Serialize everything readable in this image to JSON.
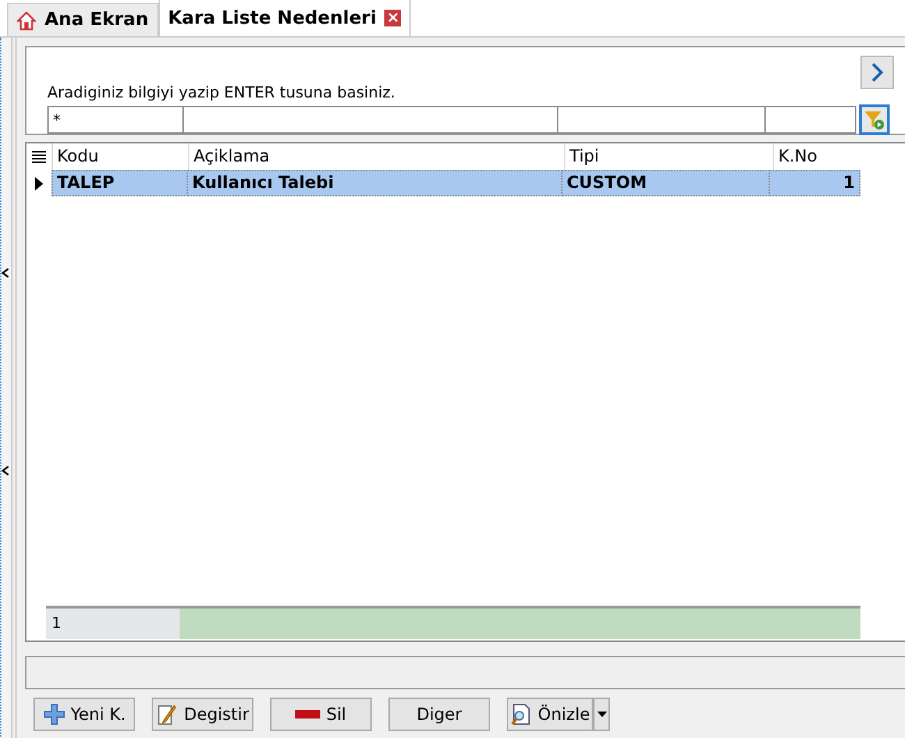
{
  "tabs": [
    {
      "label": "Ana Ekran",
      "selected": false,
      "kind": "home"
    },
    {
      "label": "Kara Liste Nedenleri",
      "selected": true,
      "kind": "closable",
      "close": "×"
    }
  ],
  "filter": {
    "hint": "Aradiginiz bilgiyi yazip ENTER tusuna basiniz.",
    "first_field_value": "*"
  },
  "grid": {
    "columns": [
      "Kodu",
      "Açiklama",
      "Tipi",
      "K.No"
    ],
    "rows": [
      {
        "cells": [
          "TALEP",
          "Kullanıcı Talebi",
          "CUSTOM",
          "1"
        ],
        "selected": true
      }
    ],
    "footer": {
      "count": "1"
    }
  },
  "buttons": [
    {
      "label": "Yeni K.",
      "kind": "add"
    },
    {
      "label": "Degistir",
      "kind": "edit"
    },
    {
      "label": "Sil",
      "kind": "delete"
    },
    {
      "label": "Diger",
      "kind": "plain"
    },
    {
      "label": "Önizle",
      "kind": "preview"
    }
  ]
}
